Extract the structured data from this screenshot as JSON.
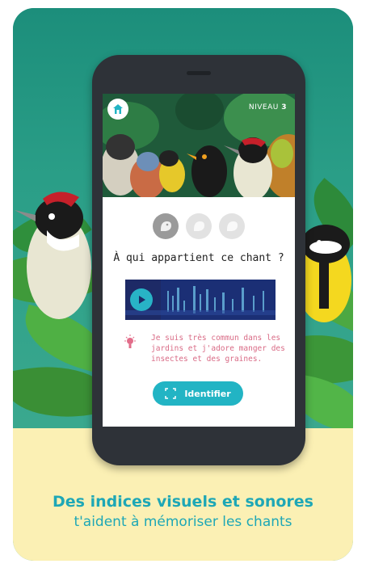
{
  "screen": {
    "level_label": "NIVEAU",
    "level_number": "3",
    "question": "À qui appartient ce chant ?",
    "hint_text": "Je suis très commun dans les jardins et j'adore manger des insectes et des graines.",
    "identify_label": "Identifier",
    "hints": [
      {
        "state": "active",
        "icon": "bird-head-icon"
      },
      {
        "state": "inactive",
        "icon": "bird-head-icon"
      },
      {
        "state": "inactive",
        "icon": "bird-head-icon"
      }
    ]
  },
  "caption": {
    "line1": "Des indices visuels et sonores",
    "line2": "t'aident à mémoriser les chants"
  },
  "colors": {
    "accent": "#22b4c4",
    "hint_text": "#d96b86",
    "caption": "#1ea7b6",
    "cream": "#fbf0b4"
  }
}
